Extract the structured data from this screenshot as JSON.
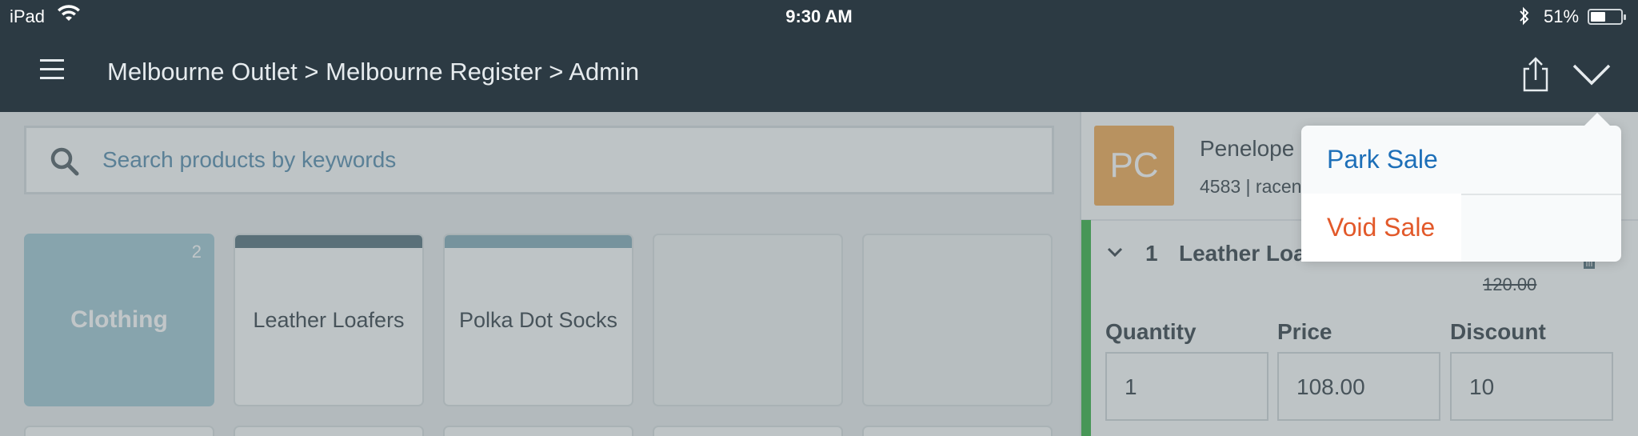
{
  "status_bar": {
    "device": "iPad",
    "time": "9:30 AM",
    "battery": "51%",
    "battery_level": 0.51,
    "wifi_icon": "wifi-icon",
    "bluetooth_icon": "bluetooth-icon"
  },
  "nav": {
    "breadcrumb": "Melbourne Outlet > Melbourne Register > Admin",
    "menu_icon": "hamburger-icon",
    "share_icon": "share-icon",
    "chevron_icon": "chevron-down-icon"
  },
  "search": {
    "placeholder": "Search products by keywords",
    "icon": "search-icon"
  },
  "tiles": [
    {
      "label": "Clothing",
      "count": "2",
      "type": "category",
      "color": "#9cc4d0"
    },
    {
      "label": "Leather Loafers",
      "type": "product",
      "bar_color": "#4f6b78"
    },
    {
      "label": "Polka Dot Socks",
      "type": "product",
      "bar_color": "#7fa8b6"
    },
    {
      "label": "",
      "type": "empty"
    },
    {
      "label": "",
      "type": "empty"
    }
  ],
  "customer": {
    "initials": "PC",
    "name": "Penelope",
    "info": "4583 | racen",
    "avatar_color": "#f0a54d"
  },
  "sale_line": {
    "quantity": "1",
    "product": "Leather Loafers",
    "price": "108.00",
    "original_price": "120.00",
    "quantity_label": "Quantity",
    "price_label": "Price",
    "discount_label": "Discount",
    "quantity_value": "1",
    "price_value": "108.00",
    "discount_value": "10",
    "accent_color": "#2ead3d",
    "trash_icon": "trash-icon"
  },
  "popover": {
    "park_sale": "Park Sale",
    "void_sale": "Void Sale",
    "park_color": "#1d6fb8",
    "void_color": "#e2592a"
  }
}
